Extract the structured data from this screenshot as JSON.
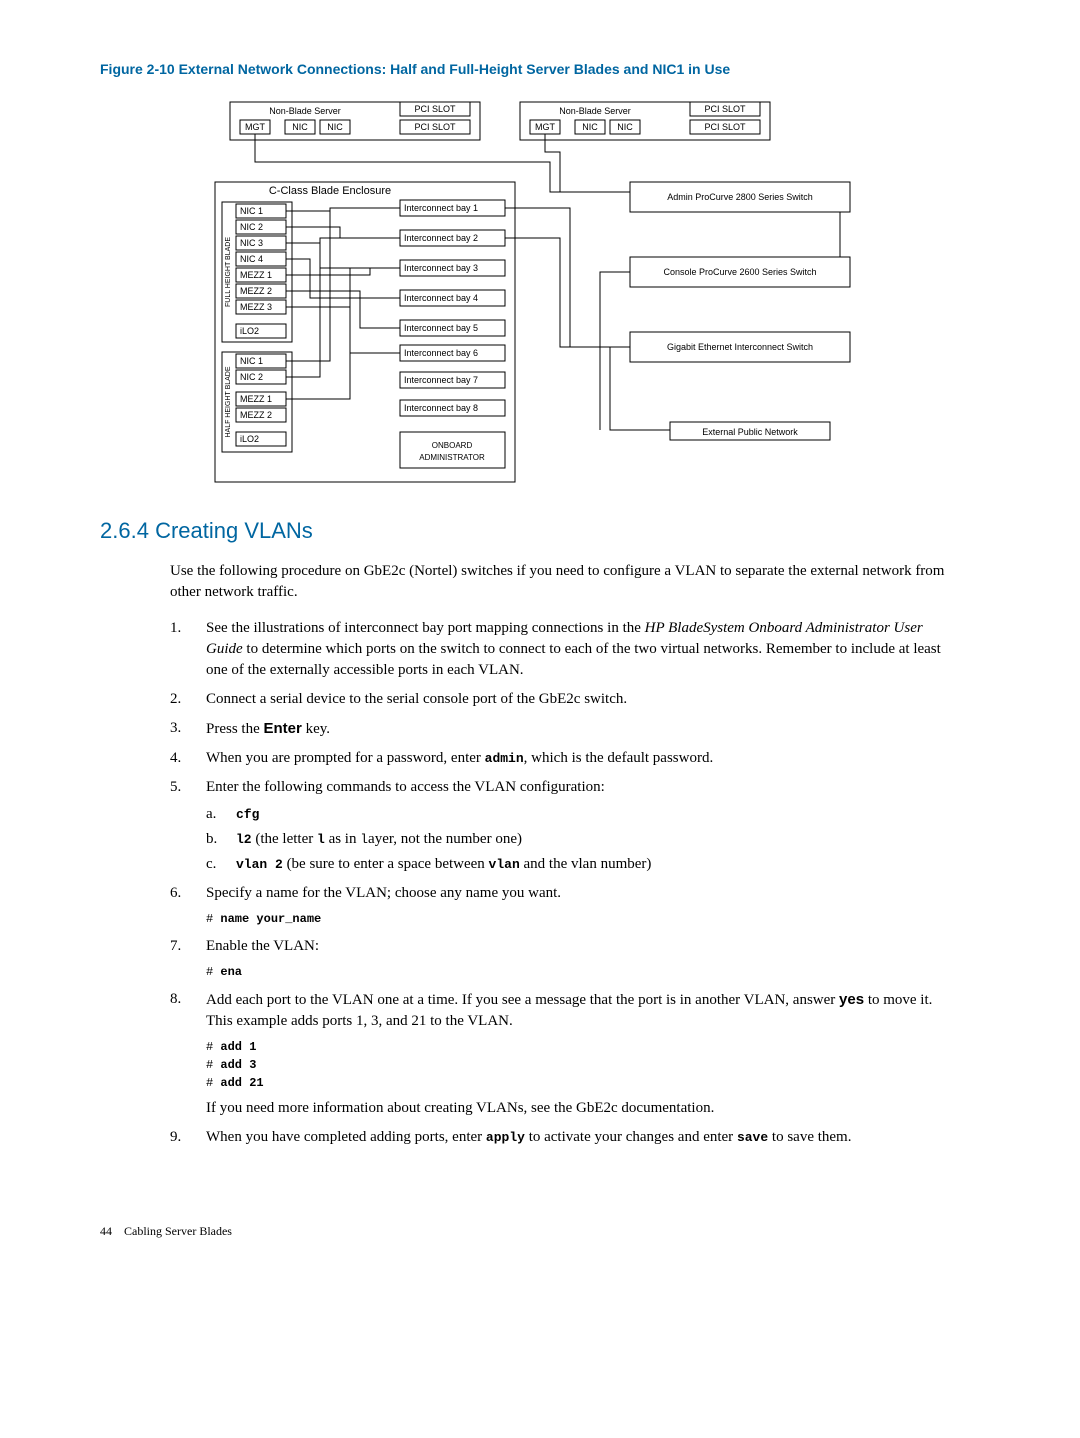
{
  "figure": {
    "title": "Figure 2-10 External Network Connections: Half and Full-Height Server Blades and NIC1 in Use",
    "server_left": {
      "title": "Non-Blade Server",
      "ports": [
        "MGT",
        "NIC",
        "NIC"
      ],
      "slots": [
        "PCI SLOT",
        "PCI SLOT"
      ]
    },
    "server_right": {
      "title": "Non-Blade Server",
      "ports": [
        "MGT",
        "NIC",
        "NIC"
      ],
      "slots": [
        "PCI SLOT",
        "PCI SLOT"
      ]
    },
    "enclosure": {
      "title": "C-Class Blade Enclosure",
      "full_label": "FULL HEIGHT BLADE",
      "half_label": "HALF HEIGHT BLADE",
      "full_rows": [
        "NIC 1",
        "NIC 2",
        "NIC 3",
        "NIC 4",
        "MEZZ 1",
        "MEZZ 2",
        "MEZZ 3",
        "iLO2"
      ],
      "half_rows": [
        "NIC 1",
        "NIC 2",
        "MEZZ 1",
        "MEZZ 2",
        "iLO2"
      ],
      "bays": [
        "Interconnect bay 1",
        "Interconnect bay 2",
        "Interconnect bay 3",
        "Interconnect bay 4",
        "Interconnect bay 5",
        "Interconnect bay 6",
        "Interconnect bay 7",
        "Interconnect bay 8"
      ],
      "oa": "ONBOARD ADMINISTRATOR"
    },
    "right_boxes": [
      "Admin ProCurve 2800 Series Switch",
      "Console ProCurve 2600 Series Switch",
      "Gigabit Ethernet Interconnect Switch",
      "External Public Network"
    ]
  },
  "section": {
    "number": "2.6.4",
    "title": "Creating VLANs",
    "intro": "Use the following procedure on GbE2c (Nortel) switches if you need to configure a VLAN to separate the external network from other network traffic.",
    "step1_a": "See the illustrations of interconnect bay port mapping connections in the ",
    "step1_em": "HP BladeSystem Onboard Administrator User Guide",
    "step1_b": " to determine which ports on the switch to connect to each of the two virtual networks. Remember to include at least one of the externally accessible ports in each VLAN.",
    "step2": "Connect a serial device to the serial console port of the GbE2c switch.",
    "step3_a": "Press the ",
    "step3_key": "Enter",
    "step3_b": " key.",
    "step4_a": "When you are prompted for a password, enter ",
    "step4_cmd": "admin",
    "step4_b": ", which is the default password.",
    "step5": "Enter the following commands to access the VLAN configuration:",
    "step5a": "cfg",
    "step5b_a": "l2",
    "step5b_b": " (the letter ",
    "step5b_c": "l",
    "step5b_d": " as in ",
    "step5b_e": "l",
    "step5b_f": "ayer, not the number one)",
    "step5c_a": "vlan 2",
    "step5c_b": " (be sure to enter a space between ",
    "step5c_c": "vlan",
    "step5c_d": " and the vlan number)",
    "step6": "Specify a name for the VLAN; choose any name you want.",
    "step6_cmd": "name your_name",
    "step7": "Enable the VLAN:",
    "step7_cmd": "ena",
    "step8_a": "Add each port to the VLAN one at a time. If you see a message that the port is in another VLAN, answer ",
    "step8_yes": "yes",
    "step8_b": " to move it. This example adds ports 1, 3, and 21 to the VLAN.",
    "step8_cmds": [
      "add 1",
      "add 3",
      "add 21"
    ],
    "step8_after": "If you need more information about creating VLANs, see the GbE2c documentation.",
    "step9_a": "When you have completed adding ports, enter ",
    "step9_apply": "apply",
    "step9_b": " to activate your changes and enter ",
    "step9_save": "save",
    "step9_c": " to save them."
  },
  "footer": {
    "page": "44",
    "chapter": "Cabling Server Blades"
  }
}
